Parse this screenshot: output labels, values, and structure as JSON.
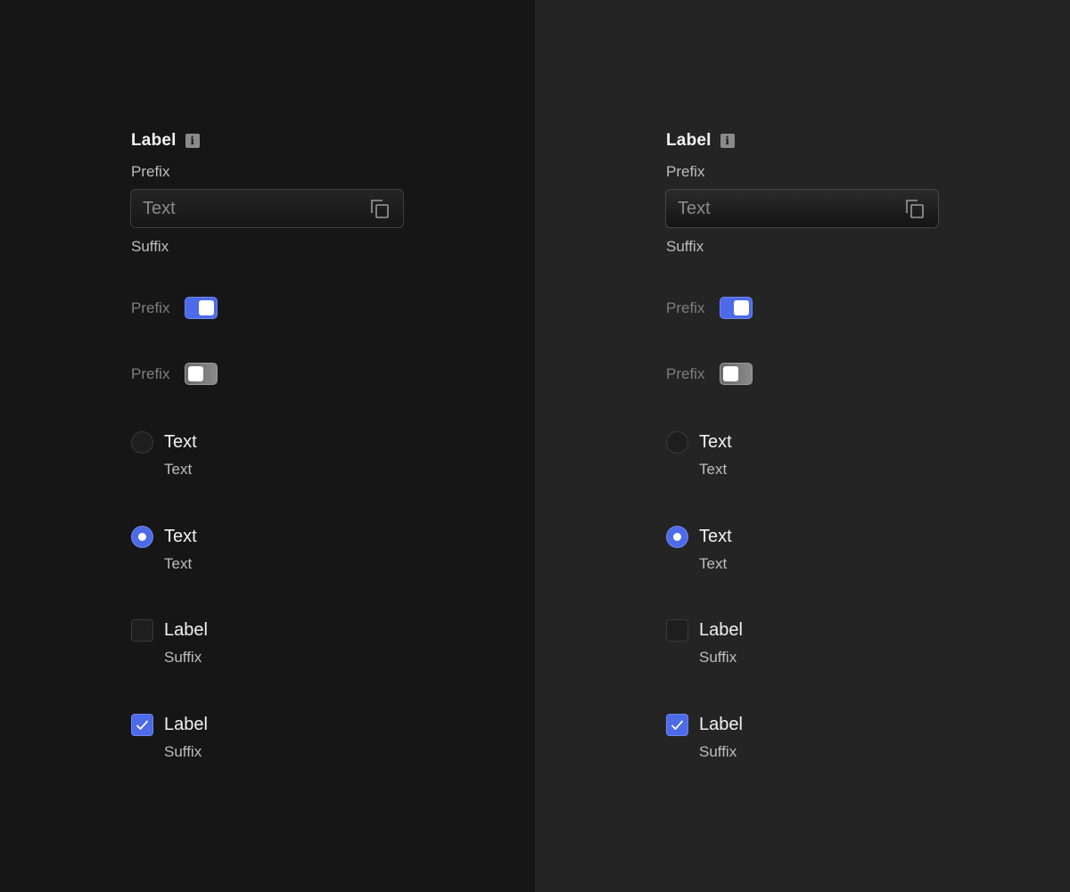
{
  "colors": {
    "accent": "#4d6ae8",
    "dark_bg": "#161616",
    "light_bg": "#242424"
  },
  "panels": [
    {
      "theme": "dark",
      "field_label": "Label",
      "info_icon": "info-icon",
      "prefix": "Prefix",
      "input_value": "Text",
      "copy_icon": "copy-icon",
      "suffix": "Suffix",
      "toggle_on_label": "Prefix",
      "toggle_off_label": "Prefix",
      "radio_off": {
        "label": "Text",
        "sub": "Text"
      },
      "radio_on": {
        "label": "Text",
        "sub": "Text"
      },
      "checkbox_off": {
        "label": "Label",
        "sub": "Suffix"
      },
      "checkbox_on": {
        "label": "Label",
        "sub": "Suffix"
      }
    },
    {
      "theme": "light",
      "field_label": "Label",
      "info_icon": "info-icon",
      "prefix": "Prefix",
      "input_value": "Text",
      "copy_icon": "copy-icon",
      "suffix": "Suffix",
      "toggle_on_label": "Prefix",
      "toggle_off_label": "Prefix",
      "radio_off": {
        "label": "Text",
        "sub": "Text"
      },
      "radio_on": {
        "label": "Text",
        "sub": "Text"
      },
      "checkbox_off": {
        "label": "Label",
        "sub": "Suffix"
      },
      "checkbox_on": {
        "label": "Label",
        "sub": "Suffix"
      }
    }
  ]
}
